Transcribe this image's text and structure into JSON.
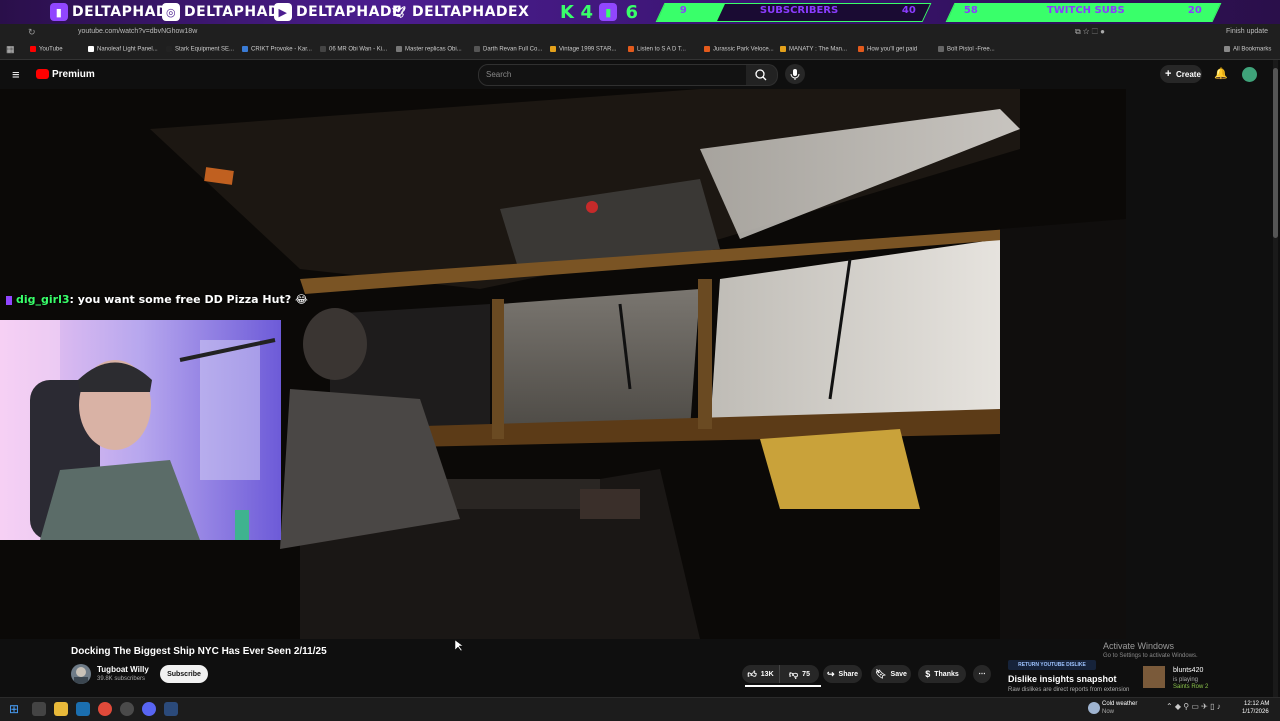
{
  "overlay": {
    "handles": [
      {
        "platform": "twitch-icon",
        "handle": "DELTAPHADE"
      },
      {
        "platform": "instagram-icon",
        "handle": "DELTAPHADE"
      },
      {
        "platform": "youtube-icon",
        "handle": "DELTAPHADE"
      },
      {
        "platform": "twitter-icon",
        "handle": "DELTAPHADEX"
      }
    ],
    "kick_label": "K",
    "kick_count": "4",
    "twitch_count": "6",
    "subscribers_goal": {
      "current": "9",
      "label": "SUBSCRIBERS",
      "target": "40",
      "progress": 0.225
    },
    "twitch_subs_goal": {
      "current": "58",
      "label": "TWITCH SUBS",
      "target": "20",
      "progress": 1.0
    }
  },
  "browser": {
    "url": "youtube.com/watch?v=dbvNGhow18w",
    "update_label": "Finish update",
    "bookmarks": [
      "YouTube",
      "Nanoleaf Light Panel...",
      "Stark Equipment SE...",
      "CRIKT Provoke - Kar...",
      "06 MR Obi Wan - Ki...",
      "Master replicas Obi...",
      "Darth Revan Full Co...",
      "Vintage 1999 STAR...",
      "Listen to S A D T...",
      "Jurassic Park Veloce...",
      "MANATY : The Man...",
      "How you'll get paid",
      "Bolt Pistol -Free..."
    ],
    "all_bookmarks": "All Bookmarks"
  },
  "youtube": {
    "logo_text": "Premium",
    "search_placeholder": "Search",
    "create_label": "Create"
  },
  "chat": {
    "user": "dig_girl3",
    "message": ": you want some free DD Pizza Hut? 😂"
  },
  "video": {
    "title": "Docking The Biggest Ship NYC Has Ever Seen 2/11/25",
    "channel": "Tugboat Willy",
    "subscribers": "39.8K subscribers",
    "subscribe_label": "Subscribe",
    "likes": "13K",
    "dislikes": "75",
    "share_label": "Share",
    "save_label": "Save",
    "thanks_label": "Thanks"
  },
  "ryd": {
    "badge": "RETURN YOUTUBE DISLIKE",
    "title": "Dislike insights snapshot",
    "text": "Raw dislikes are direct reports from extension"
  },
  "windows": {
    "activate_title": "Activate Windows",
    "activate_sub": "Go to Settings to activate Windows.",
    "toast_user": "blunts420",
    "toast_status": "is playing",
    "toast_game": "Saints Row 2",
    "weather_title": "Cold weather",
    "weather_sub": "Now",
    "time": "12:12 AM",
    "date": "1/17/2026"
  },
  "colors": {
    "accent_green": "#39ff6a",
    "overlay_purple": "#4b1d8f",
    "youtube_red": "#ff0000"
  }
}
